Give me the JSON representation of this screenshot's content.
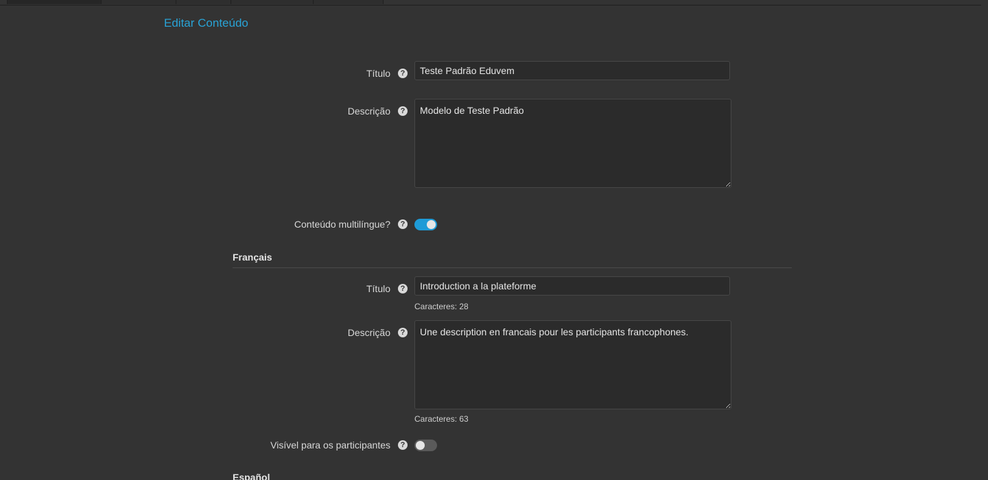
{
  "header": {
    "title": "Editar Conteúdo"
  },
  "form": {
    "title_label": "Título",
    "title_value": "Teste Padrão Eduvem",
    "description_label": "Descrição",
    "description_value": "Modelo de Teste Padrão",
    "multilingual_label": "Conteúdo multilíngue?",
    "multilingual_on": true
  },
  "french": {
    "section_title": "Français",
    "title_label": "Título",
    "title_value": "Introduction a la plateforme",
    "title_counter": "Caracteres: 28",
    "description_label": "Descrição",
    "description_value": "Une description en francais pour les participants francophones.",
    "description_counter": "Caracteres: 63",
    "visible_label": "Visível para os participantes",
    "visible_on": false
  },
  "spanish": {
    "section_title": "Español"
  },
  "icons": {
    "help": "question-circle-icon",
    "help_glyph": "?"
  },
  "colors": {
    "accent": "#29a3d6",
    "toggle_on": "#1e9bd7",
    "background": "#333333"
  }
}
